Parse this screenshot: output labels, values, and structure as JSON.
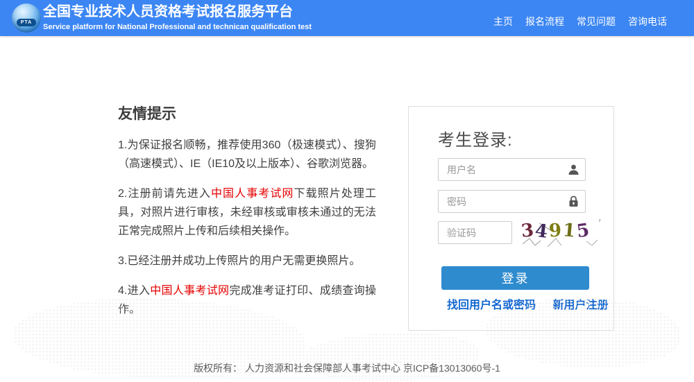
{
  "header": {
    "logo_text": "PTA",
    "title": "全国专业技术人员资格考试报名服务平台",
    "subtitle": "Service platform for National Professional and technican qualification test",
    "nav": [
      "主页",
      "报名流程",
      "常见问题",
      "咨询电话"
    ]
  },
  "tips": {
    "heading": "友情提示",
    "p1": "1.为保证报名顺畅，推荐使用360（极速模式）、搜狗（高速模式）、IE（IE10及以上版本）、谷歌浏览器。",
    "p2_pre": "2.注册前请先进入",
    "p2_link": "中国人事考试网",
    "p2_post": "下载照片处理工具，对照片进行审核，未经审核或审核未通过的无法正常完成照片上传和后续相关操作。",
    "p3": "3.已经注册并成功上传照片的用户无需更换照片。",
    "p4_pre": "4.进入",
    "p4_link": "中国人事考试网",
    "p4_post": "完成准考证打印、成绩查询操作。"
  },
  "login": {
    "heading": "考生登录:",
    "username_placeholder": "用户名",
    "password_placeholder": "密码",
    "captcha_placeholder": "验证码",
    "captcha_value": "34915",
    "captcha_digits": [
      {
        "char": "3",
        "color": "#6d2a3c"
      },
      {
        "char": "4",
        "color": "#402a5c"
      },
      {
        "char": "9",
        "color": "#7e7e14"
      },
      {
        "char": "1",
        "color": "#6f6f1a"
      },
      {
        "char": "5",
        "color": "#5e2b66"
      }
    ],
    "captcha_noise": "’",
    "login_label": "登录",
    "forgot_link": "找回用户名或密码",
    "register_link": "新用户注册"
  },
  "footer": {
    "copyright": "版权所有： 人力资源和社会保障部人事考试中心 京ICP备13013060号-1"
  },
  "colors": {
    "header_bg": "#3c86f4",
    "login_button_bg": "#2e8bce",
    "link_blue": "#1266d0",
    "alert_red": "#e60000"
  }
}
